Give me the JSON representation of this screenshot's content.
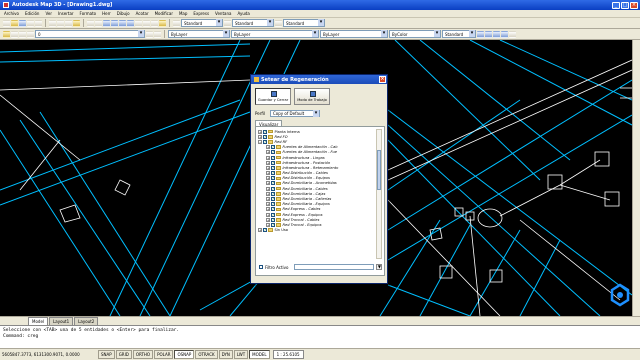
{
  "app": {
    "title": "Autodesk Map 3D - [Drawing1.dwg]",
    "window_controls": [
      "_",
      "□",
      "×"
    ]
  },
  "menu": [
    "Archivo",
    "Edición",
    "Ver",
    "Insertar",
    "Formato",
    "Herr",
    "Dibujo",
    "Acotar",
    "Modificar",
    "Map",
    "Express",
    "Ventana",
    "Ayuda"
  ],
  "toolbar": {
    "text_style": "Standard",
    "dim_style": "Standard",
    "table_style": "Standard",
    "layer": "0",
    "color": "ByLayer",
    "linetype": "ByLayer",
    "lineweight": "ByLayer",
    "plot_style": "ByColor",
    "ws_style": "Standard"
  },
  "dialog": {
    "title": "Setear de Regeneración",
    "close": "×",
    "btn_save": "Guardar y Cerrar",
    "btn_mode": "Modo de Trabajo",
    "profile_label": "Perfil",
    "profile_value": "Copy of Default",
    "tab": "Visualizar",
    "tree": [
      {
        "label": "Planta Interna",
        "level": 0,
        "italic": false
      },
      {
        "label": "Red FO",
        "level": 0,
        "italic": true
      },
      {
        "label": "Red RF",
        "level": 0,
        "italic": true
      },
      {
        "label": "Fuentes de Alimentación - Cab",
        "level": 1,
        "italic": true
      },
      {
        "label": "Fuentes de Alimentación - Fue",
        "level": 1,
        "italic": true
      },
      {
        "label": "Infraestructura - Lingas",
        "level": 1,
        "italic": true
      },
      {
        "label": "Infraestructura - Postación",
        "level": 1,
        "italic": true
      },
      {
        "label": "Infraestructura - Retenamiento",
        "level": 1,
        "italic": true
      },
      {
        "label": "Red Distribución - Cables",
        "level": 1,
        "italic": true
      },
      {
        "label": "Red Distribución - Equipos",
        "level": 1,
        "italic": true
      },
      {
        "label": "Red Domiciliaria - Acometidas",
        "level": 1,
        "italic": true
      },
      {
        "label": "Red Domiciliaria - Cables",
        "level": 1,
        "italic": true
      },
      {
        "label": "Red Domiciliaria - Cajas",
        "level": 1,
        "italic": true
      },
      {
        "label": "Red Domiciliaria - Cañerías",
        "level": 1,
        "italic": true
      },
      {
        "label": "Red Domiciliaria - Equipos",
        "level": 1,
        "italic": true
      },
      {
        "label": "Red Express - Cables",
        "level": 1,
        "italic": true
      },
      {
        "label": "Red Express - Equipos",
        "level": 1,
        "italic": true
      },
      {
        "label": "Red Troncal - Cables",
        "level": 1,
        "italic": true
      },
      {
        "label": "Red Troncal - Equipos",
        "level": 1,
        "italic": true
      },
      {
        "label": "Sin Uso",
        "level": 0,
        "italic": false
      }
    ],
    "filter_label": "Filtro Activo"
  },
  "layout_tabs": [
    "Model",
    "Layout1",
    "Layout2"
  ],
  "command": {
    "line1": "Seleccione con <TAB> una de 5 entidades o <Enter> para finalizar.",
    "line2": "Command: creg"
  },
  "status": {
    "coords": "5605847.3773, 6131300.9071, 0.0000",
    "toggles": [
      "SNAP",
      "GRID",
      "ORTHO",
      "POLAR",
      "OSNAP",
      "OTRACK",
      "DYN",
      "LWT",
      "MODEL"
    ],
    "scale": "1 : 25.6105"
  },
  "colors": {
    "canvas_bg": "#000000",
    "cyan_lines": "#00bfff",
    "white_lines": "#ffffff",
    "dialog_title": "#1b4bb8",
    "marker_blue": "#1e90ff"
  }
}
